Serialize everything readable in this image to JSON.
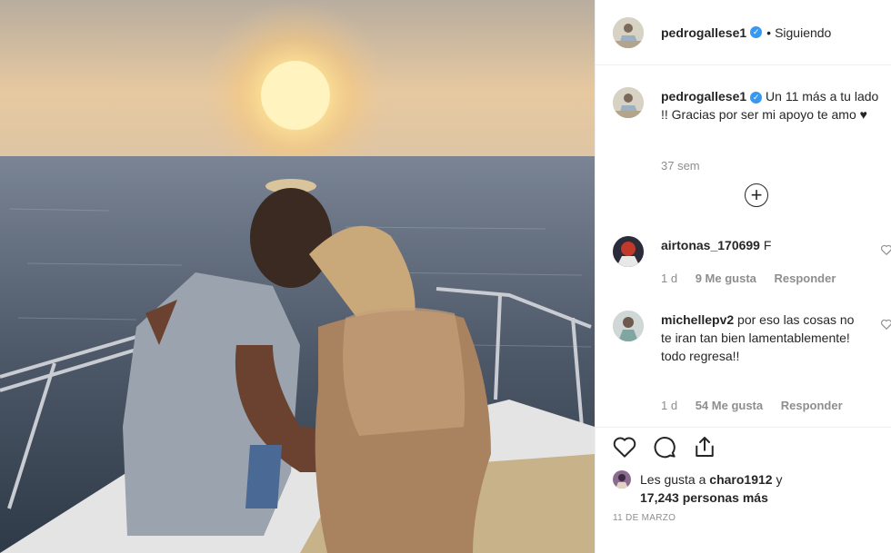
{
  "post": {
    "username": "pedrogallese1",
    "verified_icon": "verified-badge-icon",
    "follow_status": "Siguiendo",
    "caption": "Un 11 más a tu lado !! Gracias por ser mi apoyo te amo ♥",
    "caption_time": "37 sem",
    "load_more_icon": "plus-circle-icon"
  },
  "comments": [
    {
      "username": "airtonas_170699",
      "text": "F",
      "time": "1 d",
      "likes": "9 Me gusta",
      "reply": "Responder"
    },
    {
      "username": "michellepv2",
      "text": "por eso las cosas no te iran tan bien lamentablemente! todo regresa!!",
      "time": "1 d",
      "likes": "54 Me gusta",
      "reply": "Responder"
    }
  ],
  "actions": {
    "icons": [
      "heart-icon",
      "comment-icon",
      "share-icon"
    ]
  },
  "likes": {
    "prefix": "Les gusta a",
    "user": "charo1912",
    "connector": "y",
    "count": "17,243",
    "suffix": "personas más"
  },
  "date": "11 DE MARZO",
  "colors": {
    "verified": "#3897f0",
    "muted": "#8e8e8e",
    "text": "#262626"
  }
}
